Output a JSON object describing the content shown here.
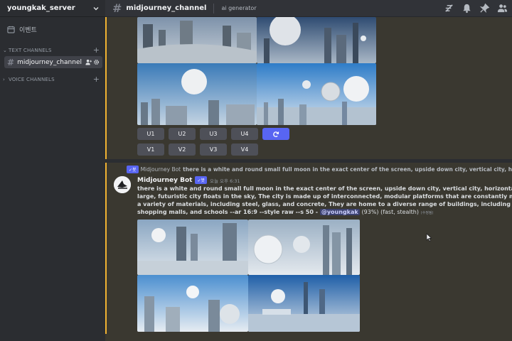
{
  "server": {
    "name": "youngkak_server"
  },
  "channel_header": {
    "name": "midjourney_channel",
    "topic": "ai generator"
  },
  "sidebar": {
    "events_label": "이벤트",
    "text_channels_label": "TEXT CHANNELS",
    "voice_channels_label": "VOICE CHANNELS",
    "active_channel": "midjourney_channel"
  },
  "upscale_buttons": [
    "U1",
    "U2",
    "U3",
    "U4"
  ],
  "variation_buttons": [
    "V1",
    "V2",
    "V3",
    "V4"
  ],
  "reply": {
    "badge": "✓봇",
    "author": "Midjourney Bot",
    "text": "there is a white and round small full moon in the exact center of the screen, upside down city, vertical city, horizontal"
  },
  "message": {
    "author": "Midjourney Bot",
    "badge": "✓봇",
    "timestamp": "오늘 오후 6:31",
    "line1": "there is a white and round small full moon in the exact center of the screen, upside down city, vertical city, horizontal city,",
    "line2": "large, futuristic city floats in the sky, The city is made up of interconnected, modular platforms that are constantly moving",
    "line3": "a variety of materials, including steel, glass, and concrete, They are home to a diverse range of buildings, including skyscra",
    "line4": "shopping malls, and schools --ar 16:9 --style raw --s 50 -",
    "mention": "@youngkak",
    "suffix": "(93%) (fast, stealth)",
    "edited": "(수정됨)"
  },
  "icons": [
    "calendar-icon",
    "hash-icon",
    "gear-icon",
    "person-add-icon",
    "threads-icon",
    "bell-icon",
    "pin-icon",
    "members-icon",
    "refresh-icon",
    "chevron-down-icon"
  ]
}
